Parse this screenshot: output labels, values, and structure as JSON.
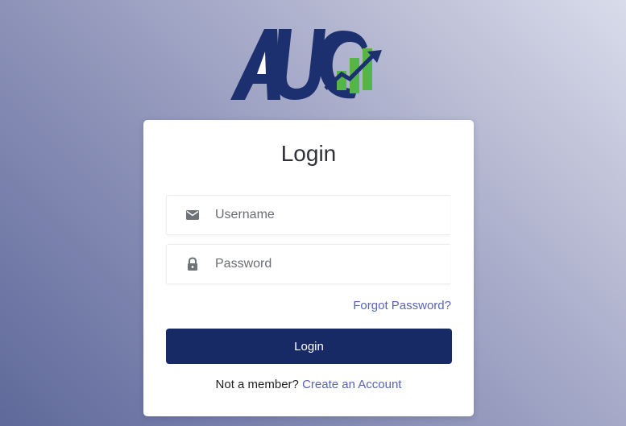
{
  "brand": {
    "logo_text": "AUC",
    "colors": {
      "navy": "#1c2f6e",
      "green": "#55b546"
    }
  },
  "login": {
    "title": "Login",
    "username": {
      "placeholder": "Username",
      "value": "",
      "icon": "mail-icon"
    },
    "password": {
      "placeholder": "Password",
      "value": "",
      "icon": "lock-icon"
    },
    "forgot_label": "Forgot Password?",
    "submit_label": "Login",
    "signup_prompt": "Not a member?",
    "signup_link": "Create an Account"
  },
  "theme": {
    "accent": "#172a66",
    "link": "#5a63b5"
  }
}
